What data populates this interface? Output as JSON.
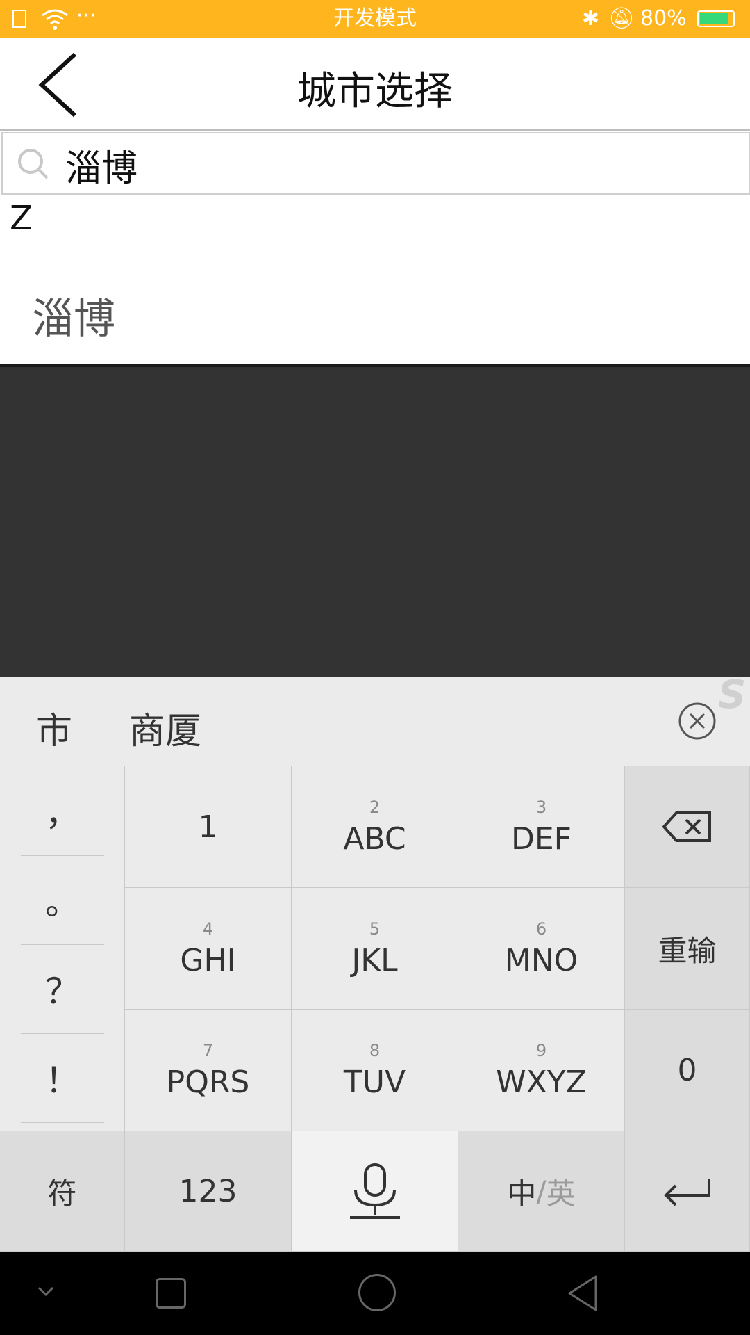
{
  "status_bar": {
    "mode": "开发模式",
    "battery": "80%"
  },
  "header": {
    "title": "城市选择"
  },
  "search": {
    "value": "淄博"
  },
  "list": {
    "section_letter": "Z",
    "items": [
      {
        "label": "淄博"
      }
    ]
  },
  "keyboard": {
    "candidates": [
      "市",
      "商厦"
    ],
    "punctuation": [
      "，",
      "。",
      "？",
      "！"
    ],
    "keys": [
      {
        "num": "",
        "letters": "1"
      },
      {
        "num": "2",
        "letters": "ABC"
      },
      {
        "num": "3",
        "letters": "DEF"
      },
      {
        "num": "4",
        "letters": "GHI"
      },
      {
        "num": "5",
        "letters": "JKL"
      },
      {
        "num": "6",
        "letters": "MNO"
      },
      {
        "num": "7",
        "letters": "PQRS"
      },
      {
        "num": "8",
        "letters": "TUV"
      },
      {
        "num": "9",
        "letters": "WXYZ"
      }
    ],
    "reinput": "重输",
    "zero": "0",
    "symbols": "符",
    "numbers": "123",
    "lang_zh": "中",
    "lang_sep": "/",
    "lang_en": "英"
  },
  "colors": {
    "status_bar": "#FFB61E",
    "overlay": "#333333",
    "keyboard_bg": "#EBEBEB"
  }
}
